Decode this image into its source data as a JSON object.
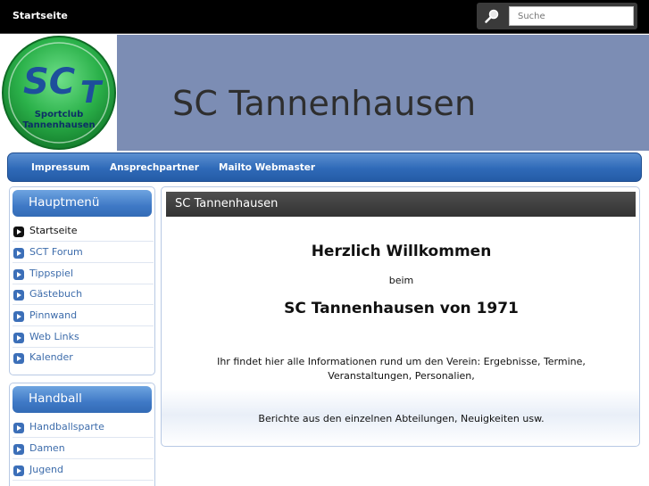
{
  "topbar": {
    "home_label": "Startseite",
    "search_placeholder": "Suche",
    "search_icon": "magnifier-icon"
  },
  "header": {
    "logo": {
      "initials_big": "SC",
      "initials_small": "T",
      "line1": "Sportclub",
      "line2": "Tannenhausen"
    },
    "site_title": "SC Tannenhausen"
  },
  "nav": {
    "items": [
      "Impressum",
      "Ansprechpartner",
      "Mailto Webmaster"
    ]
  },
  "sidebar": {
    "main_menu": {
      "title": "Hauptmenü",
      "items": [
        {
          "label": "Startseite",
          "active": true
        },
        {
          "label": "SCT Forum"
        },
        {
          "label": "Tippspiel"
        },
        {
          "label": "Gästebuch"
        },
        {
          "label": "Pinnwand"
        },
        {
          "label": "Web Links"
        },
        {
          "label": "Kalender"
        }
      ]
    },
    "handball": {
      "title": "Handball",
      "items": [
        {
          "label": "Handballsparte"
        },
        {
          "label": "Damen"
        },
        {
          "label": "Jugend"
        }
      ]
    }
  },
  "main": {
    "header": "SC Tannenhausen",
    "welcome": "Herzlich  Willkommen",
    "beim": "beim",
    "club_line": "SC Tannenhausen von 1971",
    "paragraph1_line1": "Ihr findet hier alle Informationen rund um den Verein: Ergebnisse, Termine,",
    "paragraph1_line2": "Veranstaltungen, Personalien,",
    "paragraph2": "Berichte aus den einzelnen Abteilungen, Neuigkeiten usw."
  },
  "colors": {
    "header_bg": "#7c8db4",
    "nav_blue": "#2f6ab8",
    "logo_green": "#2bb14a",
    "logo_blue": "#1d4f9c",
    "link_blue": "#3d6cab"
  }
}
